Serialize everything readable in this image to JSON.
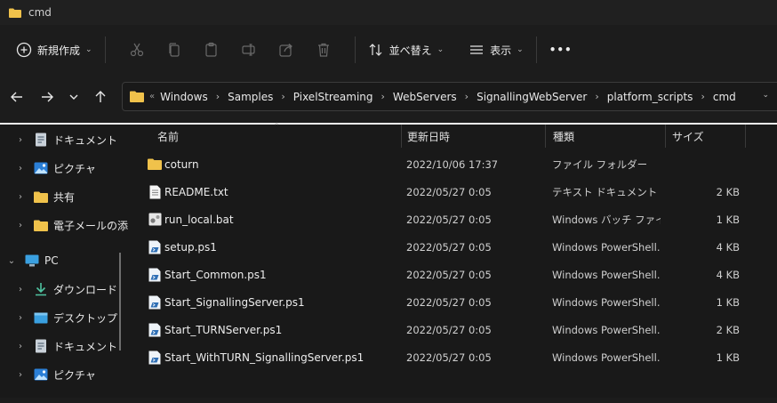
{
  "window": {
    "title": "cmd"
  },
  "toolbar": {
    "new_label": "新規作成",
    "sort_label": "並べ替え",
    "view_label": "表示",
    "more_label": "•••"
  },
  "address": {
    "crumbs": [
      "Windows",
      "Samples",
      "PixelStreaming",
      "WebServers",
      "SignallingWebServer",
      "platform_scripts",
      "cmd"
    ],
    "lead": "«"
  },
  "sidebar": {
    "items": [
      {
        "label": "ドキュメント",
        "icon": "document-icon"
      },
      {
        "label": "ピクチャ",
        "icon": "pictures-icon"
      },
      {
        "label": "共有",
        "icon": "folder-icon"
      },
      {
        "label": "電子メールの添",
        "icon": "folder-icon"
      },
      {
        "label": "PC",
        "icon": "pc-icon"
      },
      {
        "label": "ダウンロード",
        "icon": "download-icon"
      },
      {
        "label": "デスクトップ",
        "icon": "desktop-icon"
      },
      {
        "label": "ドキュメント",
        "icon": "document-icon"
      },
      {
        "label": "ピクチャ",
        "icon": "pictures-icon"
      }
    ]
  },
  "columns": {
    "name": "名前",
    "date": "更新日時",
    "type": "種類",
    "size": "サイズ"
  },
  "files": [
    {
      "name": "coturn",
      "date": "2022/10/06 17:37",
      "type": "ファイル フォルダー",
      "size": "",
      "icon": "folder-icon"
    },
    {
      "name": "README.txt",
      "date": "2022/05/27 0:05",
      "type": "テキスト ドキュメント",
      "size": "2 KB",
      "icon": "text-file-icon"
    },
    {
      "name": "run_local.bat",
      "date": "2022/05/27 0:05",
      "type": "Windows バッチ ファイル",
      "size": "1 KB",
      "icon": "batch-file-icon"
    },
    {
      "name": "setup.ps1",
      "date": "2022/05/27 0:05",
      "type": "Windows PowerShell...",
      "size": "4 KB",
      "icon": "powershell-file-icon"
    },
    {
      "name": "Start_Common.ps1",
      "date": "2022/05/27 0:05",
      "type": "Windows PowerShell...",
      "size": "4 KB",
      "icon": "powershell-file-icon"
    },
    {
      "name": "Start_SignallingServer.ps1",
      "date": "2022/05/27 0:05",
      "type": "Windows PowerShell...",
      "size": "1 KB",
      "icon": "powershell-file-icon"
    },
    {
      "name": "Start_TURNServer.ps1",
      "date": "2022/05/27 0:05",
      "type": "Windows PowerShell...",
      "size": "2 KB",
      "icon": "powershell-file-icon"
    },
    {
      "name": "Start_WithTURN_SignallingServer.ps1",
      "date": "2022/05/27 0:05",
      "type": "Windows PowerShell...",
      "size": "1 KB",
      "icon": "powershell-file-icon"
    }
  ],
  "colors": {
    "folder": "#f0c24b",
    "background": "#191919",
    "accent_line": "#f2f2f2"
  }
}
